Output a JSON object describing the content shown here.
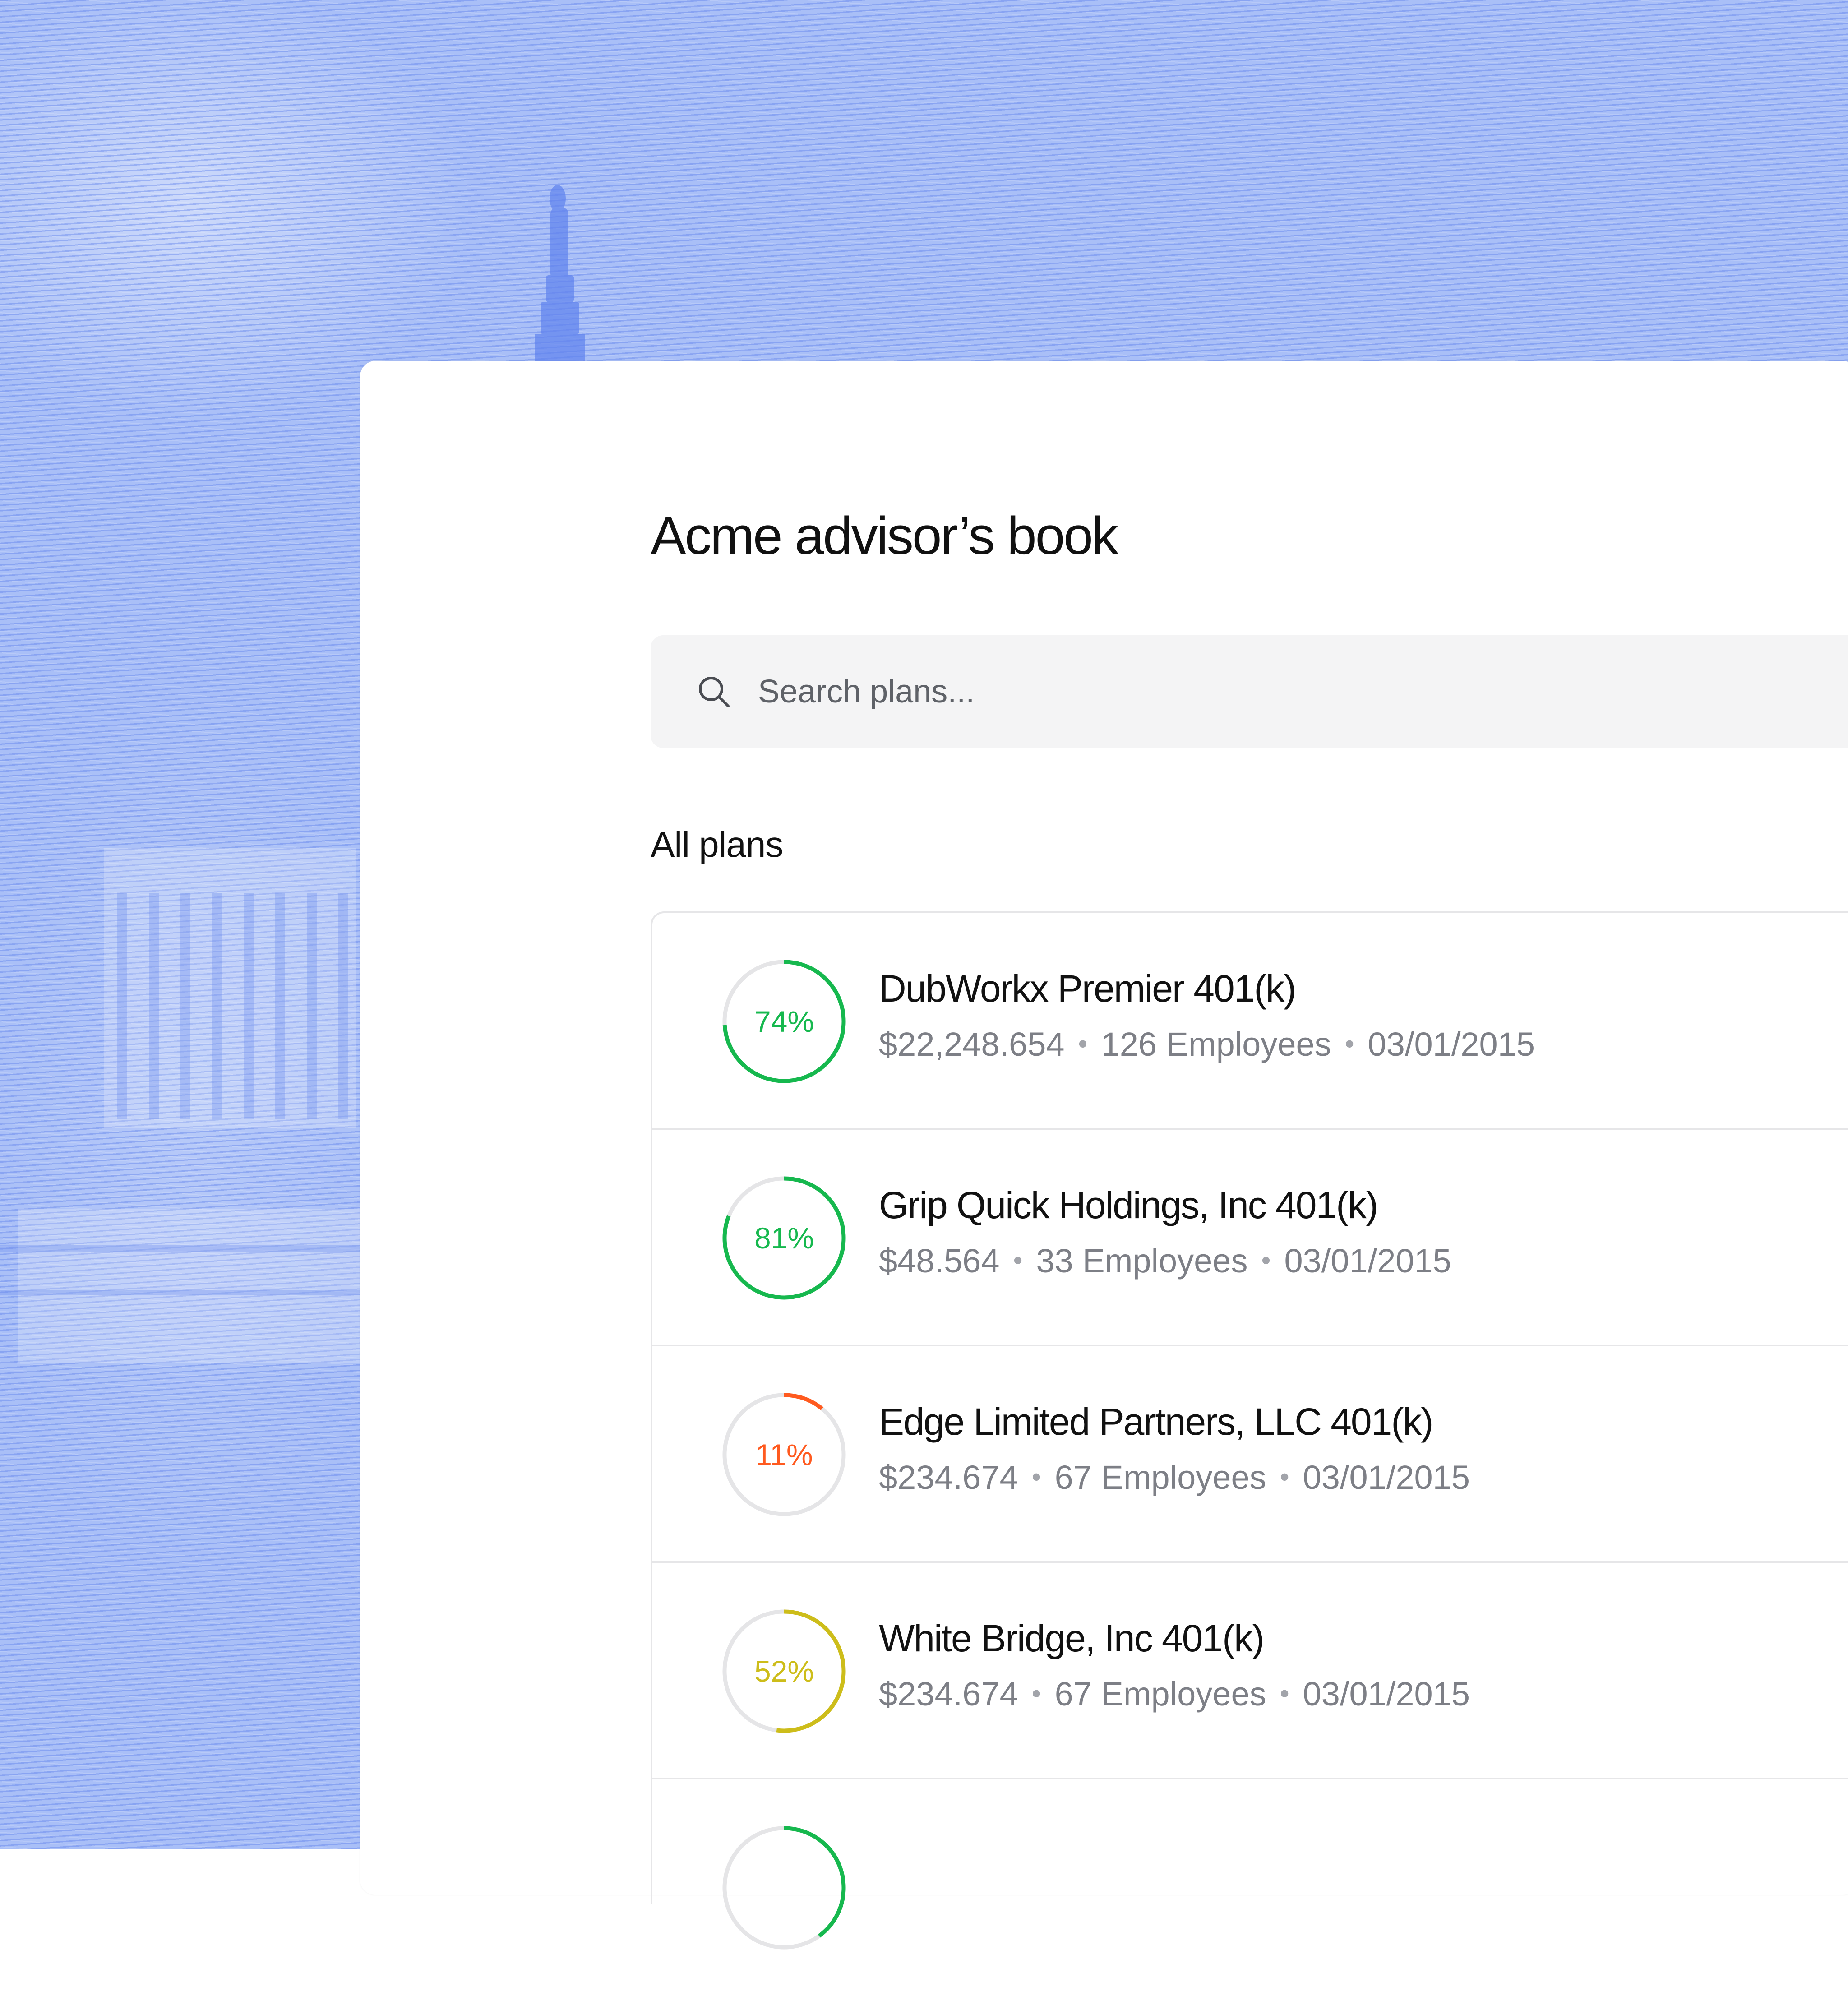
{
  "colors": {
    "green": "#16b84e",
    "orange": "#ff5a1f",
    "yellow": "#cdbd1a",
    "track": "#e5e5e7"
  },
  "page": {
    "title": "Acme advisor’s book",
    "search": {
      "placeholder": "Search plans..."
    },
    "section_label": "All plans"
  },
  "plans": [
    {
      "percent": 74,
      "percent_label": "74%",
      "color": "green",
      "name": "DubWorkx Premier 401(k)",
      "amount": "$22,248.654",
      "employees": "126 Employees",
      "date": "03/01/2015"
    },
    {
      "percent": 81,
      "percent_label": "81%",
      "color": "green",
      "name": "Grip Quick Holdings, Inc 401(k)",
      "amount": "$48.564",
      "employees": "33 Employees",
      "date": "03/01/2015"
    },
    {
      "percent": 11,
      "percent_label": "11%",
      "color": "orange",
      "name": "Edge Limited Partners, LLC 401(k)",
      "amount": "$234.674",
      "employees": "67 Employees",
      "date": "03/01/2015"
    },
    {
      "percent": 52,
      "percent_label": "52%",
      "color": "yellow",
      "name": "White Bridge, Inc 401(k)",
      "amount": "$234.674",
      "employees": "67 Employees",
      "date": "03/01/2015"
    },
    {
      "percent": 40,
      "percent_label": "",
      "color": "green",
      "name": "",
      "amount": "",
      "employees": "",
      "date": ""
    }
  ]
}
